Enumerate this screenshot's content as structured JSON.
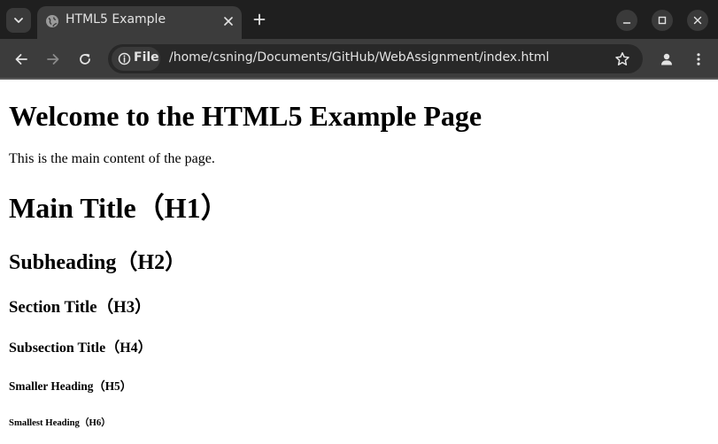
{
  "browser": {
    "tab": {
      "title": "HTML5 Example",
      "favicon": "globe-icon"
    },
    "address_bar": {
      "chip_label": "File",
      "url": "/home/csning/Documents/GitHub/WebAssignment/index.html"
    },
    "icons": {
      "tab_search": "chevron-down-icon",
      "tab_close": "close-icon",
      "new_tab": "plus-icon",
      "minimize": "minimize-icon",
      "maximize": "maximize-icon",
      "close_window": "close-icon",
      "back": "back-arrow-icon",
      "forward": "forward-arrow-icon",
      "reload": "reload-icon",
      "site_info": "info-icon",
      "bookmark": "star-icon",
      "profile": "person-icon",
      "menu": "kebab-menu-icon"
    },
    "colors": {
      "tabstrip": "#1f1f1f",
      "toolbar": "#3c3c3c",
      "omnibox": "#282828",
      "text": "#e3e3e3",
      "forward_disabled": "#8a8a8a"
    }
  },
  "page": {
    "welcome_heading": "Welcome to the HTML5 Example Page",
    "main_paragraph": "This is the main content of the page.",
    "h1": "Main Title（H1）",
    "h2": "Subheading（H2）",
    "h3": "Section Title（H3）",
    "h4": "Subsection Title（H4）",
    "h5": "Smaller Heading（H5）",
    "h6": "Smallest Heading（H6）"
  }
}
